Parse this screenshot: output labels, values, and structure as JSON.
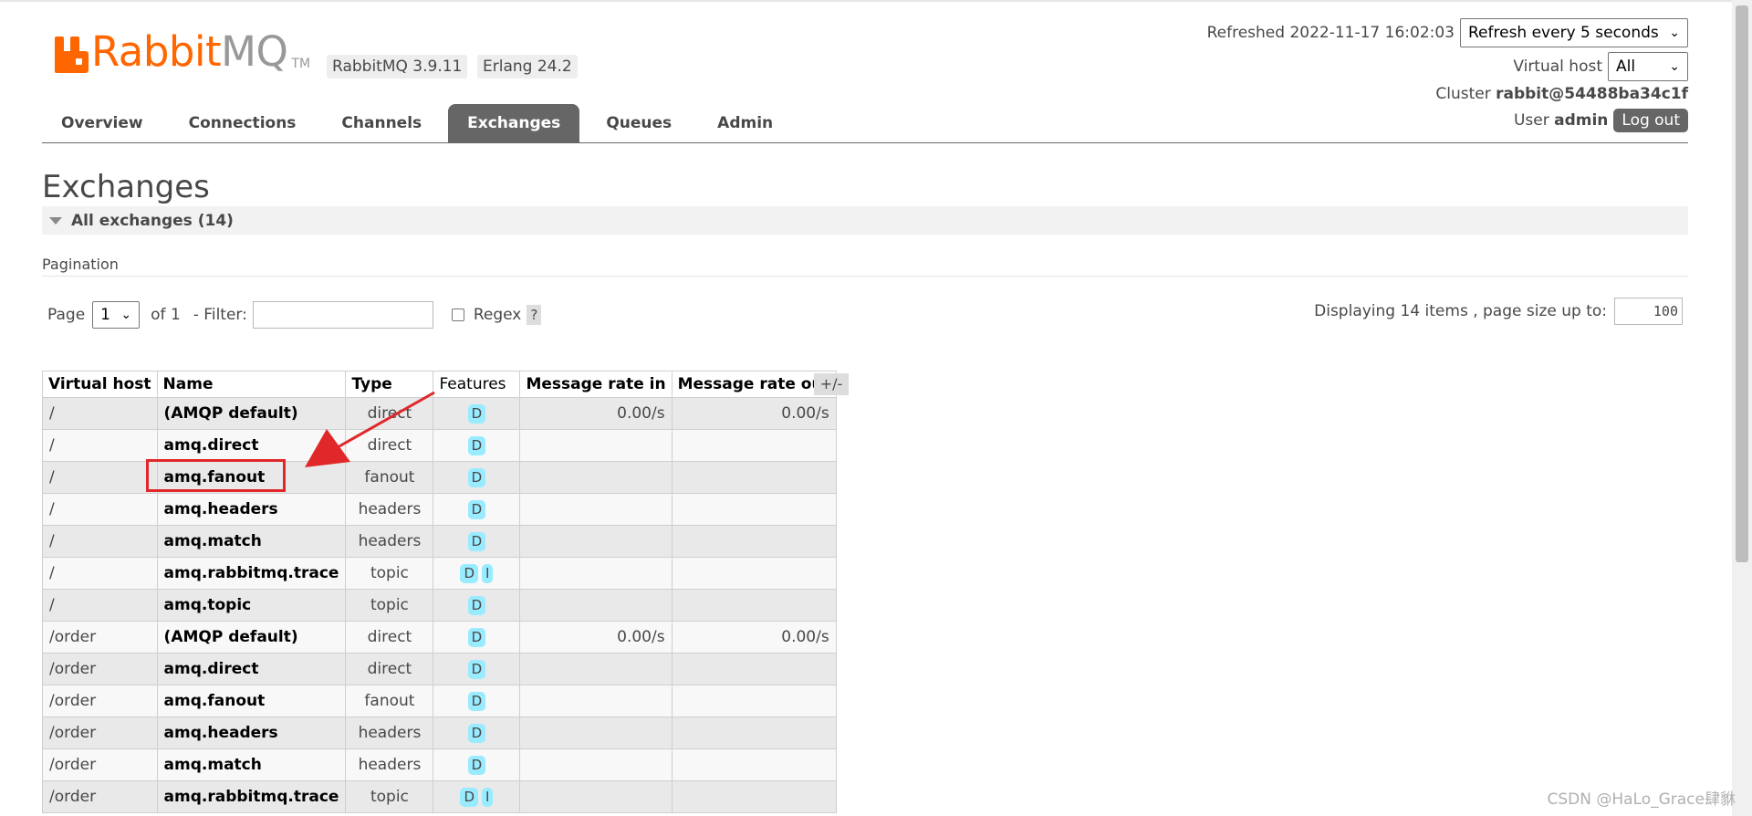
{
  "brand": {
    "rabbit": "Rabbit",
    "mq": "MQ",
    "tm": "TM",
    "version": "RabbitMQ 3.9.11",
    "erlang": "Erlang 24.2"
  },
  "status": {
    "refreshed": "Refreshed 2022-11-17 16:02:03",
    "refresh_select": "Refresh every 5 seconds",
    "vhost_label": "Virtual host",
    "vhost_select": "All",
    "cluster_label": "Cluster",
    "cluster_name": "rabbit@54488ba34c1f",
    "user_label": "User",
    "user_name": "admin",
    "logout": "Log out"
  },
  "nav": {
    "tabs": [
      {
        "label": "Overview"
      },
      {
        "label": "Connections"
      },
      {
        "label": "Channels"
      },
      {
        "label": "Exchanges"
      },
      {
        "label": "Queues"
      },
      {
        "label": "Admin"
      }
    ],
    "active": "Exchanges"
  },
  "page": {
    "title": "Exchanges",
    "section": "All exchanges (14)"
  },
  "pagination": {
    "title": "Pagination",
    "page_label": "Page",
    "page_value": "1",
    "of_label": "of 1",
    "filter_label": "- Filter:",
    "regex_label": "Regex",
    "help": "?",
    "display_text": "Displaying 14 items , page size up to:",
    "page_size": "100"
  },
  "table": {
    "columns": [
      "Virtual host",
      "Name",
      "Type",
      "Features",
      "Message rate in",
      "Message rate out"
    ],
    "toggle": "+/-",
    "rows": [
      {
        "vhost": "/",
        "name": "(AMQP default)",
        "type": "direct",
        "features": [
          "D"
        ],
        "rate_in": "0.00/s",
        "rate_out": "0.00/s"
      },
      {
        "vhost": "/",
        "name": "amq.direct",
        "type": "direct",
        "features": [
          "D"
        ],
        "rate_in": "",
        "rate_out": ""
      },
      {
        "vhost": "/",
        "name": "amq.fanout",
        "type": "fanout",
        "features": [
          "D"
        ],
        "rate_in": "",
        "rate_out": ""
      },
      {
        "vhost": "/",
        "name": "amq.headers",
        "type": "headers",
        "features": [
          "D"
        ],
        "rate_in": "",
        "rate_out": ""
      },
      {
        "vhost": "/",
        "name": "amq.match",
        "type": "headers",
        "features": [
          "D"
        ],
        "rate_in": "",
        "rate_out": ""
      },
      {
        "vhost": "/",
        "name": "amq.rabbitmq.trace",
        "type": "topic",
        "features": [
          "D",
          "I"
        ],
        "rate_in": "",
        "rate_out": ""
      },
      {
        "vhost": "/",
        "name": "amq.topic",
        "type": "topic",
        "features": [
          "D"
        ],
        "rate_in": "",
        "rate_out": ""
      },
      {
        "vhost": "/order",
        "name": "(AMQP default)",
        "type": "direct",
        "features": [
          "D"
        ],
        "rate_in": "0.00/s",
        "rate_out": "0.00/s"
      },
      {
        "vhost": "/order",
        "name": "amq.direct",
        "type": "direct",
        "features": [
          "D"
        ],
        "rate_in": "",
        "rate_out": ""
      },
      {
        "vhost": "/order",
        "name": "amq.fanout",
        "type": "fanout",
        "features": [
          "D"
        ],
        "rate_in": "",
        "rate_out": ""
      },
      {
        "vhost": "/order",
        "name": "amq.headers",
        "type": "headers",
        "features": [
          "D"
        ],
        "rate_in": "",
        "rate_out": ""
      },
      {
        "vhost": "/order",
        "name": "amq.match",
        "type": "headers",
        "features": [
          "D"
        ],
        "rate_in": "",
        "rate_out": ""
      },
      {
        "vhost": "/order",
        "name": "amq.rabbitmq.trace",
        "type": "topic",
        "features": [
          "D",
          "I"
        ],
        "rate_in": "",
        "rate_out": ""
      }
    ]
  },
  "watermark": "CSDN @HaLo_Grace肆貅",
  "colors": {
    "brand_orange": "#ff6600",
    "annotation_red": "#e0282a",
    "badge_blue": "#99ebff",
    "active_tab": "#666666"
  }
}
